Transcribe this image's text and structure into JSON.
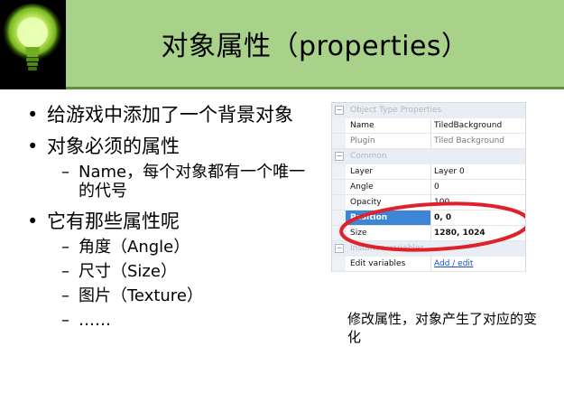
{
  "slide": {
    "title": "对象属性（properties）",
    "bullets": [
      {
        "text": "给游戏中添加了一个背景对象"
      },
      {
        "text": "对象必须的属性",
        "subs": [
          "Name，每个对象都有一个唯一的代号"
        ]
      },
      {
        "text": "它有那些属性呢",
        "subs": [
          "角度（Angle）",
          "尺寸（Size）",
          "图片（Texture）",
          "……"
        ]
      }
    ],
    "caption": "修改属性，对象产生了对应的变化"
  },
  "panel": {
    "sections": [
      "Object Type Properties",
      "Common",
      "Instance variables"
    ],
    "rows": {
      "name": {
        "label": "Name",
        "value": "TiledBackground"
      },
      "plugin": {
        "label": "Plugin",
        "value": "Tiled Background"
      },
      "layer": {
        "label": "Layer",
        "value": "Layer 0"
      },
      "angle": {
        "label": "Angle",
        "value": "0"
      },
      "opacity": {
        "label": "Opacity",
        "value": "100"
      },
      "position": {
        "label": "Position",
        "value": "0, 0"
      },
      "size": {
        "label": "Size",
        "value": "1280, 1024"
      },
      "editvars": {
        "label": "Edit variables",
        "value": "Add / edit"
      }
    }
  },
  "colors": {
    "header": "#a8d18a",
    "highlight_ellipse": "#e0202a",
    "selection": "#3d86d6"
  },
  "icons": {
    "logo": "lightbulb-icon"
  }
}
